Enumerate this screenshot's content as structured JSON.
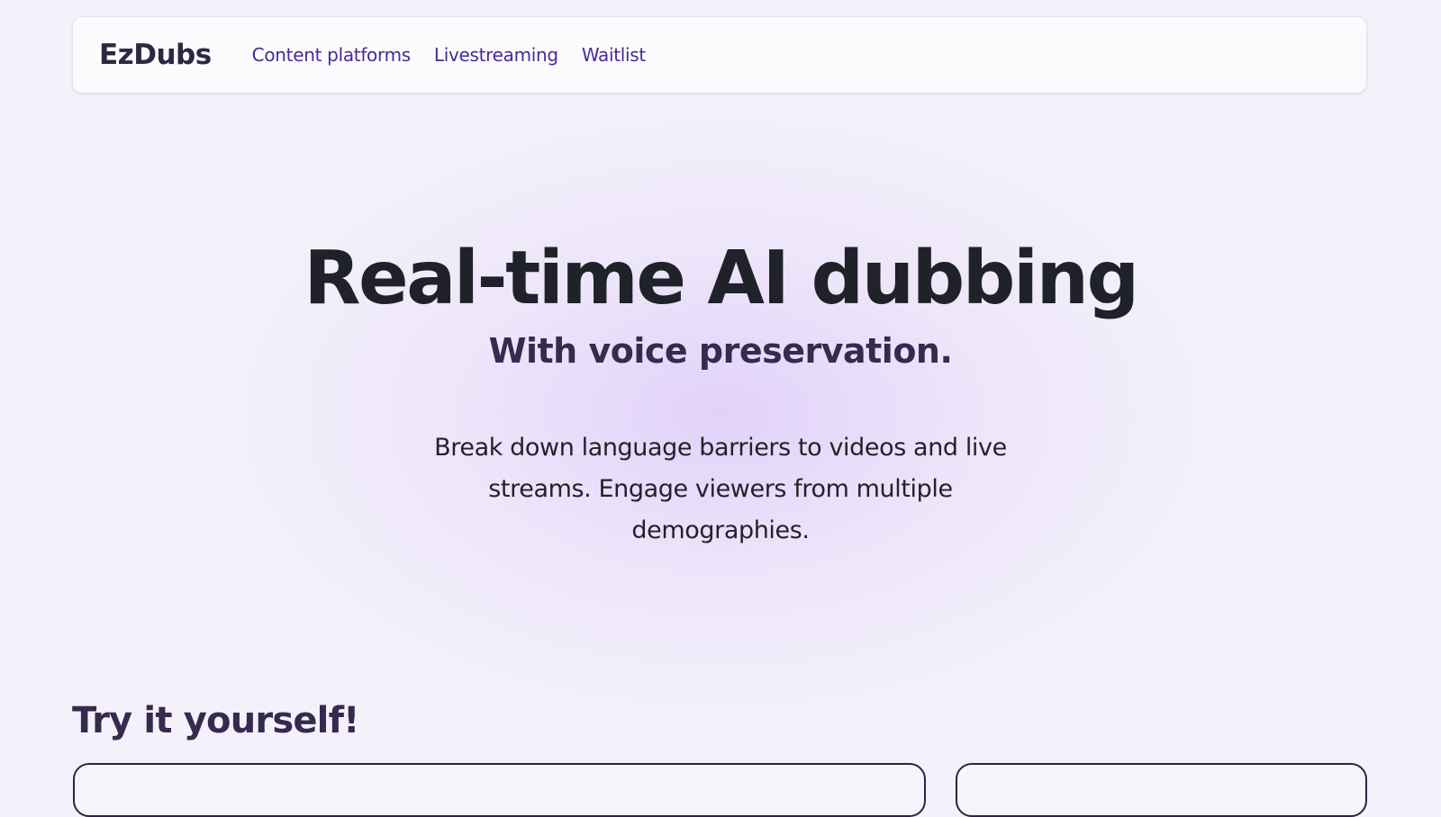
{
  "brand": {
    "name": "EzDubs"
  },
  "nav": {
    "links": [
      {
        "label": "Content platforms"
      },
      {
        "label": "Livestreaming"
      },
      {
        "label": "Waitlist"
      }
    ]
  },
  "hero": {
    "title": "Real-time AI dubbing",
    "subtitle": "With voice preservation.",
    "description": "Break down language barriers to videos and live streams. Engage viewers from multiple demographies."
  },
  "demo": {
    "heading": "Try it yourself!"
  },
  "colors": {
    "background": "#f4f1fa",
    "nav_link": "#4a2a96",
    "heading_dark": "#1f2229",
    "heading_purple": "#352b4f"
  }
}
